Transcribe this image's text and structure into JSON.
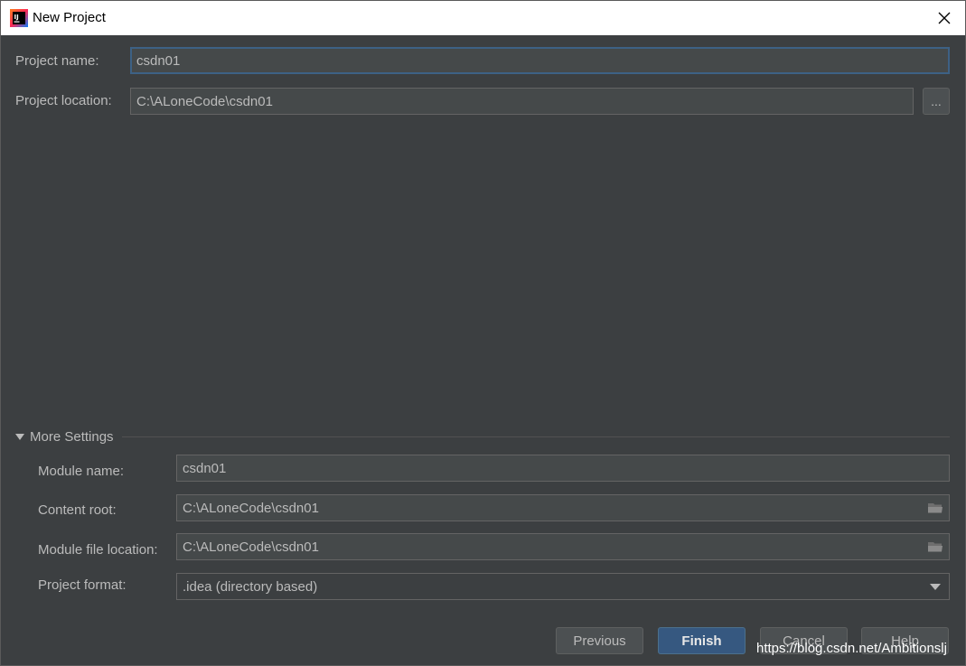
{
  "window": {
    "title": "New Project",
    "app_icon": "intellij-idea-icon",
    "close_icon": "close-icon"
  },
  "project": {
    "name_label": "Project name:",
    "name_value": "csdn01",
    "location_label": "Project location:",
    "location_value": "C:\\ALoneCode\\csdn01",
    "browse_label": "..."
  },
  "more_settings": {
    "header": "More Settings",
    "module_name_label": "Module name:",
    "module_name_value": "csdn01",
    "content_root_label": "Content root:",
    "content_root_value": "C:\\ALoneCode\\csdn01",
    "module_file_label": "Module file location:",
    "module_file_value": "C:\\ALoneCode\\csdn01",
    "format_label": "Project format:",
    "format_value": ".idea (directory based)"
  },
  "buttons": {
    "previous": "Previous",
    "finish": "Finish",
    "cancel": "Cancel",
    "help": "Help"
  },
  "watermark": "https://blog.csdn.net/Ambitionslj",
  "colors": {
    "background": "#3c3f41",
    "field_bg": "#45494a",
    "focus_border": "#3d6185",
    "primary_button": "#365880",
    "text": "#bbbbbb"
  }
}
